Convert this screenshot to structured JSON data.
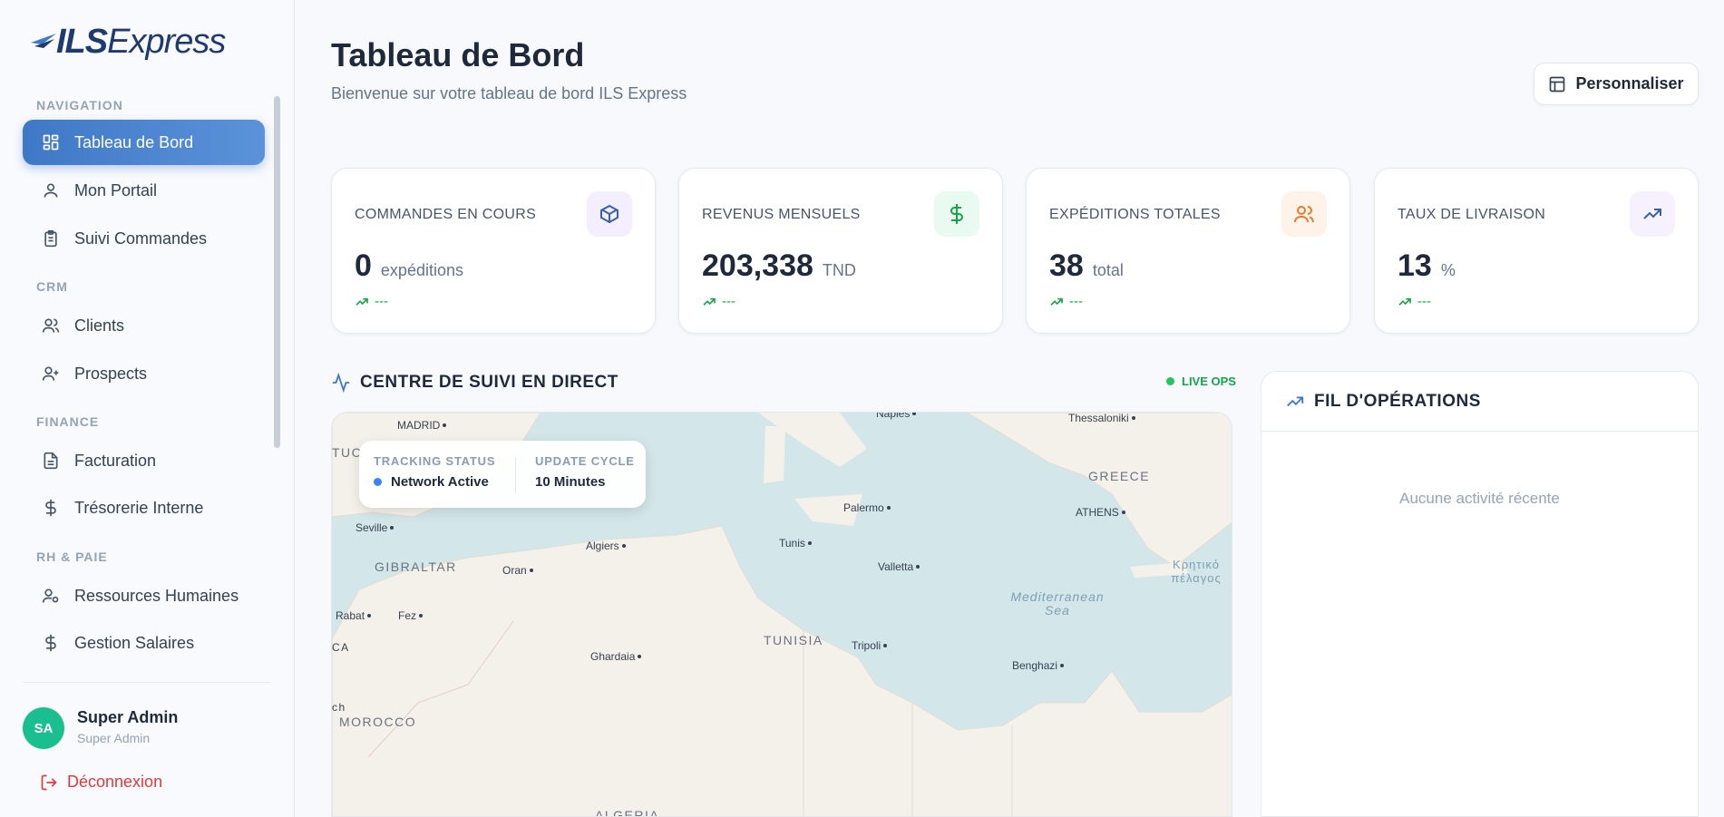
{
  "brand": {
    "logo_text_bold": "ILS",
    "logo_text": "Express"
  },
  "sidebar": {
    "sections": [
      "NAVIGATION",
      "CRM",
      "FINANCE",
      "RH & PAIE"
    ],
    "items": [
      {
        "label": "Tableau de Bord",
        "icon": "dashboard-icon",
        "active": true
      },
      {
        "label": "Mon Portail",
        "icon": "user-icon"
      },
      {
        "label": "Suivi Commandes",
        "icon": "clipboard-icon"
      },
      {
        "label": "Clients",
        "icon": "users-icon"
      },
      {
        "label": "Prospects",
        "icon": "user-plus-icon"
      },
      {
        "label": "Facturation",
        "icon": "file-text-icon"
      },
      {
        "label": "Trésorerie Interne",
        "icon": "dollar-icon"
      },
      {
        "label": "Ressources Humaines",
        "icon": "user-cog-icon"
      },
      {
        "label": "Gestion Salaires",
        "icon": "dollar-icon"
      }
    ],
    "user": {
      "initials": "SA",
      "name": "Super Admin",
      "role": "Super Admin"
    },
    "logout_label": "Déconnexion"
  },
  "header": {
    "title": "Tableau de Bord",
    "subtitle": "Bienvenue sur votre tableau de bord ILS Express",
    "customize_label": "Personnaliser"
  },
  "kpis": [
    {
      "label": "COMMANDES EN COURS",
      "value": "0",
      "unit": "expéditions",
      "trend": "---",
      "icon": "package-icon",
      "icon_color": "#3b5fa8",
      "icon_bg": "#f3efff"
    },
    {
      "label": "REVENUS MENSUELS",
      "value": "203,338",
      "unit": "TND",
      "trend": "---",
      "icon": "dollar-icon",
      "icon_color": "#16a34a",
      "icon_bg": "#e9faf1"
    },
    {
      "label": "EXPÉDITIONS TOTALES",
      "value": "38",
      "unit": "total",
      "trend": "---",
      "icon": "users-icon",
      "icon_color": "#ea7a2a",
      "icon_bg": "#fff2e8"
    },
    {
      "label": "TAUX DE LIVRAISON",
      "value": "13",
      "unit": "%",
      "trend": "---",
      "icon": "trending-up-icon",
      "icon_color": "#3b5fa8",
      "icon_bg": "#f6f1ff"
    }
  ],
  "live": {
    "title": "CENTRE DE SUIVI EN DIRECT",
    "badge": "LIVE OPS",
    "tracking_status_label": "TRACKING STATUS",
    "tracking_status_value": "Network Active",
    "update_cycle_label": "UPDATE CYCLE",
    "update_cycle_value": "10 Minutes",
    "map": {
      "cities": [
        "MADRID",
        "Napies",
        "Thessaloniki",
        "Seville",
        "Palermo",
        "ATHENS",
        "Algiers",
        "Tunis",
        "Oran",
        "Valletta",
        "Rabat",
        "Fez",
        "Tripoli",
        "Ghardaia",
        "Benghazi"
      ],
      "countries": [
        "GIBRALTAR",
        "TUNISIA",
        "GREECE",
        "MOROCCO",
        "ALGERIA",
        "TUC",
        "CA",
        "ch"
      ],
      "sea": "Mediterranean Sea",
      "sea_greek": "Κρητικό πέλαγος"
    }
  },
  "ops": {
    "title": "FIL D'OPÉRATIONS",
    "empty_text": "Aucune activité récente"
  },
  "colors": {
    "accent": "#3f78c6",
    "success": "#16a34a",
    "danger": "#e23a3a"
  }
}
